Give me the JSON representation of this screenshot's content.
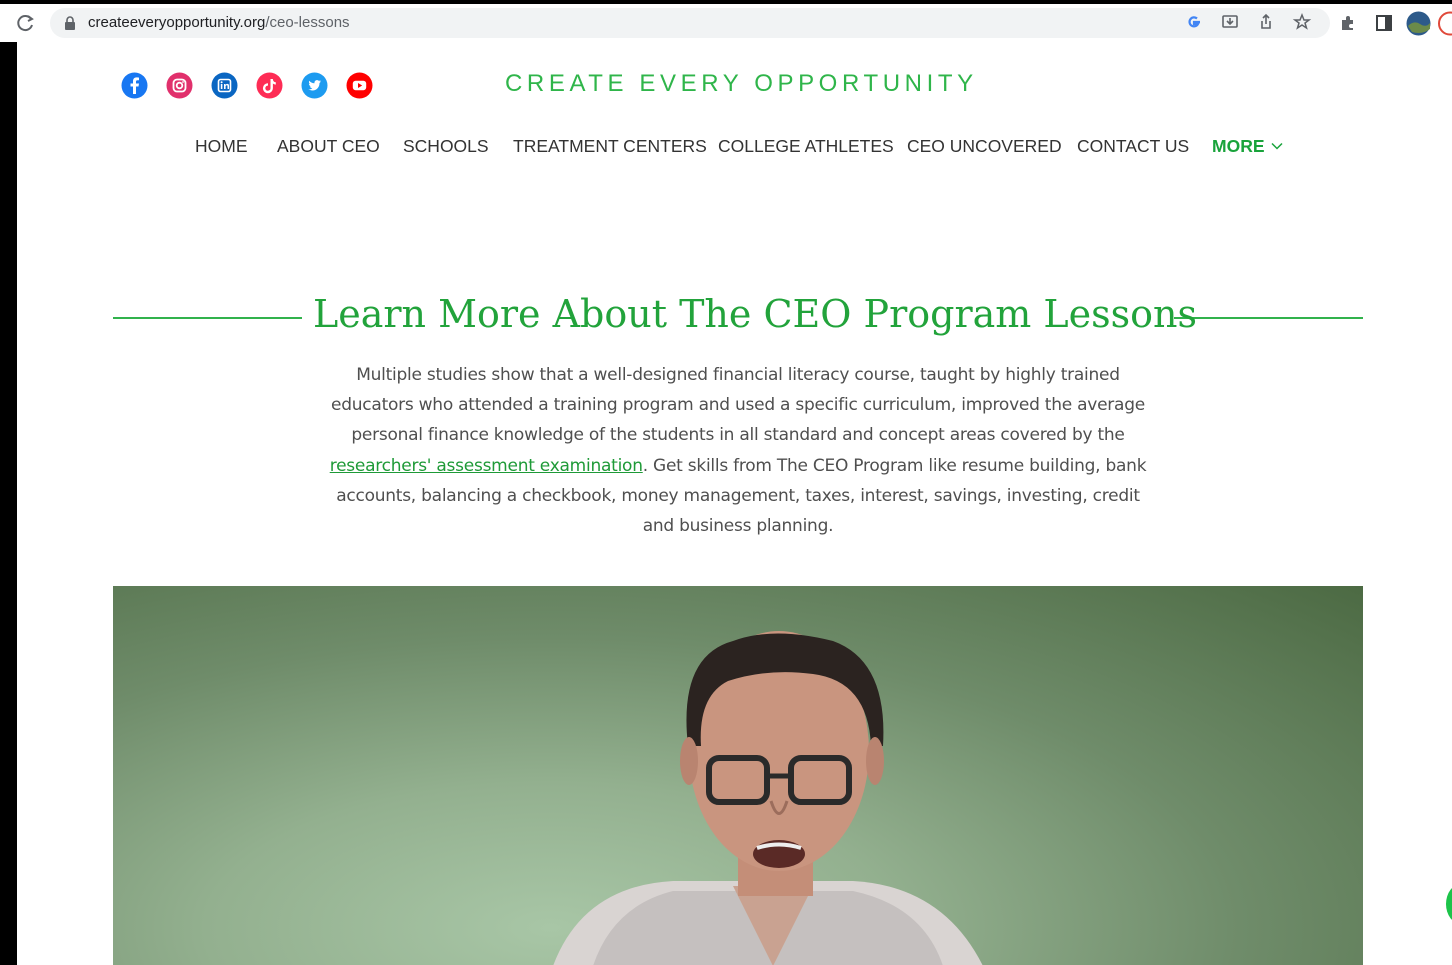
{
  "browser": {
    "url_host": "createeveryopportunity.org",
    "url_path": "/ceo-lessons"
  },
  "site": {
    "title": "CREATE EVERY OPPORTUNITY",
    "social": [
      "facebook-icon",
      "instagram-icon",
      "linkedin-icon",
      "tiktok-icon",
      "twitter-icon",
      "youtube-icon"
    ]
  },
  "nav": {
    "items": [
      "HOME",
      "ABOUT CEO",
      "SCHOOLS",
      "TREATMENT CENTERS",
      "COLLEGE ATHLETES",
      "CEO UNCOVERED",
      "CONTACT US"
    ],
    "more": "MORE"
  },
  "content": {
    "heading": "Learn More About The CEO Program Lessons",
    "para_before": "Multiple studies show that a well-designed financial literacy course, taught by highly trained educators who attended a training program and used a specific curriculum, improved the average personal finance knowledge of the students in all standard and concept areas covered by the ",
    "link_text": "researchers' assessment examination",
    "para_after": ". Get skills from The CEO Program like resume building, bank accounts, balancing a checkbook, money management, taxes, interest, savings, investing, credit and business planning."
  },
  "colors": {
    "brand_green": "#2fb54a",
    "heading_green": "#22a33b",
    "facebook": "#1877f2",
    "instagram": "#e1306c",
    "linkedin": "#0a66c2",
    "tiktok": "#fe2c55",
    "twitter": "#1d9bf0",
    "youtube": "#ff0000"
  }
}
